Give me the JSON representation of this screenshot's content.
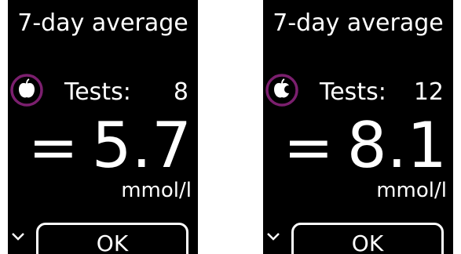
{
  "screens": [
    {
      "title": "7-day average",
      "meal_icon": "apple-whole-icon",
      "tests_label": "Tests:",
      "tests_count": "8",
      "equals": "=",
      "value": "5.7",
      "unit": "mmol/l",
      "ok_label": "OK",
      "chevron_icon": "chevron-down-icon"
    },
    {
      "title": "7-day average",
      "meal_icon": "apple-bitten-icon",
      "tests_label": "Tests:",
      "tests_count": "12",
      "equals": "=",
      "value": "8.1",
      "unit": "mmol/l",
      "ok_label": "OK",
      "chevron_icon": "chevron-down-icon"
    }
  ],
  "colors": {
    "screen_background": "#000000",
    "text": "#ffffff",
    "highlight_ring": "#7b1f6e"
  }
}
